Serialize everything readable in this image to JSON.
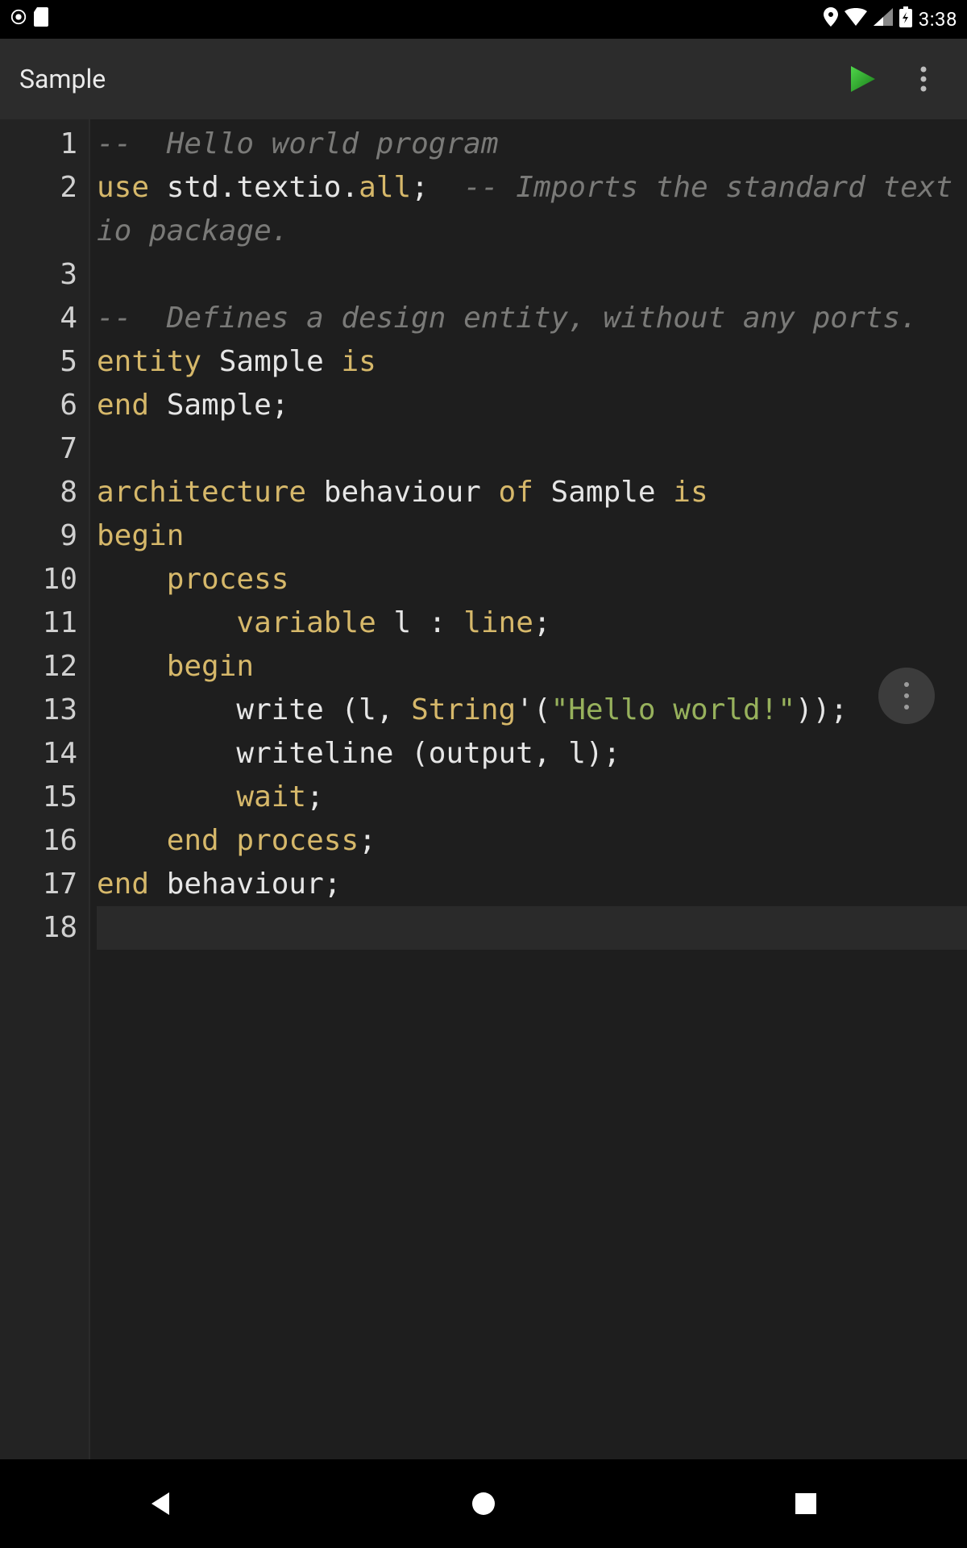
{
  "status_bar": {
    "time": "3:38"
  },
  "toolbar": {
    "title": "Sample"
  },
  "editor": {
    "line_numbers": [
      "1",
      "2",
      "",
      "3",
      "4",
      "",
      "5",
      "6",
      "7",
      "8",
      "9",
      "10",
      "11",
      "12",
      "13",
      "",
      "14",
      "15",
      "16",
      "17",
      "18"
    ],
    "lines": [
      {
        "tokens": [
          {
            "t": "--  Hello world program",
            "c": "cm"
          }
        ]
      },
      {
        "tokens": [
          {
            "t": "use",
            "c": "kw"
          },
          {
            "t": " ",
            "c": ""
          },
          {
            "t": "std",
            "c": "id"
          },
          {
            "t": ".",
            "c": "pn"
          },
          {
            "t": "textio",
            "c": "id"
          },
          {
            "t": ".",
            "c": "pn"
          },
          {
            "t": "all",
            "c": "kw"
          },
          {
            "t": ";",
            "c": "pn"
          },
          {
            "t": "  ",
            "c": ""
          },
          {
            "t": "-- Imports the standard textio package.",
            "c": "cm"
          }
        ]
      },
      {
        "tokens": [
          {
            "t": "",
            "c": ""
          }
        ]
      },
      {
        "tokens": [
          {
            "t": "--  Defines a design entity, without any ports.",
            "c": "cm"
          }
        ]
      },
      {
        "tokens": [
          {
            "t": "entity",
            "c": "kw"
          },
          {
            "t": " Sample ",
            "c": "id"
          },
          {
            "t": "is",
            "c": "kw"
          }
        ]
      },
      {
        "tokens": [
          {
            "t": "end",
            "c": "kw"
          },
          {
            "t": " Sample",
            "c": "id"
          },
          {
            "t": ";",
            "c": "pn"
          }
        ]
      },
      {
        "tokens": [
          {
            "t": "",
            "c": ""
          }
        ]
      },
      {
        "tokens": [
          {
            "t": "architecture",
            "c": "kw"
          },
          {
            "t": " behaviour ",
            "c": "id"
          },
          {
            "t": "of",
            "c": "kw"
          },
          {
            "t": " Sample ",
            "c": "id"
          },
          {
            "t": "is",
            "c": "kw"
          }
        ]
      },
      {
        "tokens": [
          {
            "t": "begin",
            "c": "kw"
          }
        ]
      },
      {
        "tokens": [
          {
            "t": "    ",
            "c": ""
          },
          {
            "t": "process",
            "c": "kw"
          }
        ]
      },
      {
        "tokens": [
          {
            "t": "        ",
            "c": ""
          },
          {
            "t": "variable",
            "c": "kw"
          },
          {
            "t": " l ",
            "c": "id"
          },
          {
            "t": ":",
            "c": "pn"
          },
          {
            "t": " ",
            "c": ""
          },
          {
            "t": "line",
            "c": "ty"
          },
          {
            "t": ";",
            "c": "pn"
          }
        ]
      },
      {
        "tokens": [
          {
            "t": "    ",
            "c": ""
          },
          {
            "t": "begin",
            "c": "kw"
          }
        ]
      },
      {
        "tokens": [
          {
            "t": "        write (l, ",
            "c": "id"
          },
          {
            "t": "String",
            "c": "ty"
          },
          {
            "t": "'",
            "c": "pn"
          },
          {
            "t": "(",
            "c": "pn"
          },
          {
            "t": "\"Hello world!\"",
            "c": "str"
          },
          {
            "t": ")",
            "c": "pn"
          },
          {
            "t": ")",
            "c": "pn"
          },
          {
            "t": ";",
            "c": "pn"
          }
        ]
      },
      {
        "tokens": [
          {
            "t": "        writeline (output, l)",
            "c": "id"
          },
          {
            "t": ";",
            "c": "pn"
          }
        ]
      },
      {
        "tokens": [
          {
            "t": "        ",
            "c": ""
          },
          {
            "t": "wait",
            "c": "kw"
          },
          {
            "t": ";",
            "c": "pn"
          }
        ]
      },
      {
        "tokens": [
          {
            "t": "    ",
            "c": ""
          },
          {
            "t": "end",
            "c": "kw"
          },
          {
            "t": " ",
            "c": ""
          },
          {
            "t": "process",
            "c": "kw"
          },
          {
            "t": ";",
            "c": "pn"
          }
        ]
      },
      {
        "tokens": [
          {
            "t": "end",
            "c": "kw"
          },
          {
            "t": " behaviour",
            "c": "id"
          },
          {
            "t": ";",
            "c": "pn"
          }
        ]
      },
      {
        "tokens": [
          {
            "t": "",
            "c": ""
          }
        ],
        "current": true
      }
    ]
  }
}
